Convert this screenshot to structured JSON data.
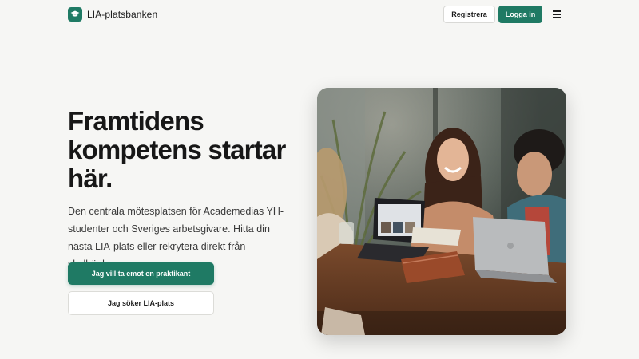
{
  "header": {
    "logo_text": "LIA-platsbanken",
    "register_label": "Registrera",
    "login_label": "Logga in"
  },
  "hero": {
    "title": "Framtidens kompetens startar här.",
    "description": "Den centrala mötesplatsen för Academedias YH-studenter och Sveriges arbetsgivare. Hitta din nästa LIA-plats eller rekrytera direkt från skolbänken.",
    "primary_cta": "Jag vill ta emot en praktikant",
    "secondary_cta": "Jag söker LIA-plats"
  },
  "colors": {
    "accent": "#1f7a64",
    "background": "#f6f6f4"
  },
  "icons": {
    "logo": "graduation-cap-icon",
    "menu": "hamburger-menu-icon"
  }
}
